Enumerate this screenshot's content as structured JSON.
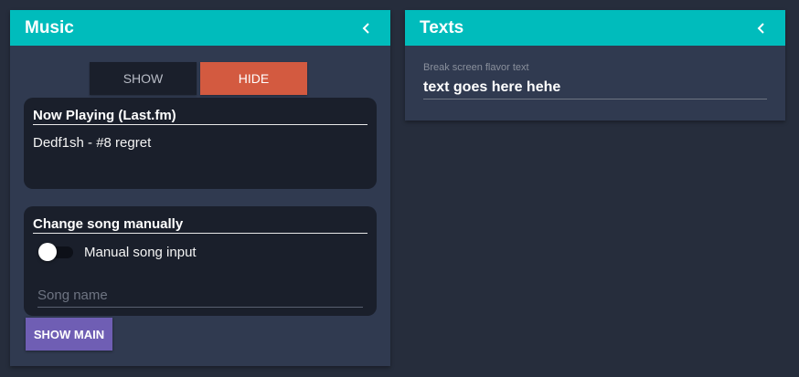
{
  "music": {
    "title": "Music",
    "collapse_icon": "chevron-left-icon",
    "show_label": "SHOW",
    "hide_label": "HIDE",
    "now_playing": {
      "title": "Now Playing (Last.fm)",
      "song": "Dedf1sh - #8 regret"
    },
    "change_song": {
      "title": "Change song manually",
      "switch_label": "Manual song input",
      "switch_on": false,
      "input_placeholder": "Song name",
      "input_value": ""
    },
    "show_main_label": "SHOW MAIN"
  },
  "texts": {
    "title": "Texts",
    "collapse_icon": "chevron-left-icon",
    "field_label": "Break screen flavor text",
    "field_value": "text goes here hehe"
  },
  "colors": {
    "background": "#262d3c",
    "panel": "#303a50",
    "header": "#00bcbc",
    "card": "#1a1f2b",
    "hide_button": "#d35a40",
    "show_main_button": "#6f5eb4"
  }
}
